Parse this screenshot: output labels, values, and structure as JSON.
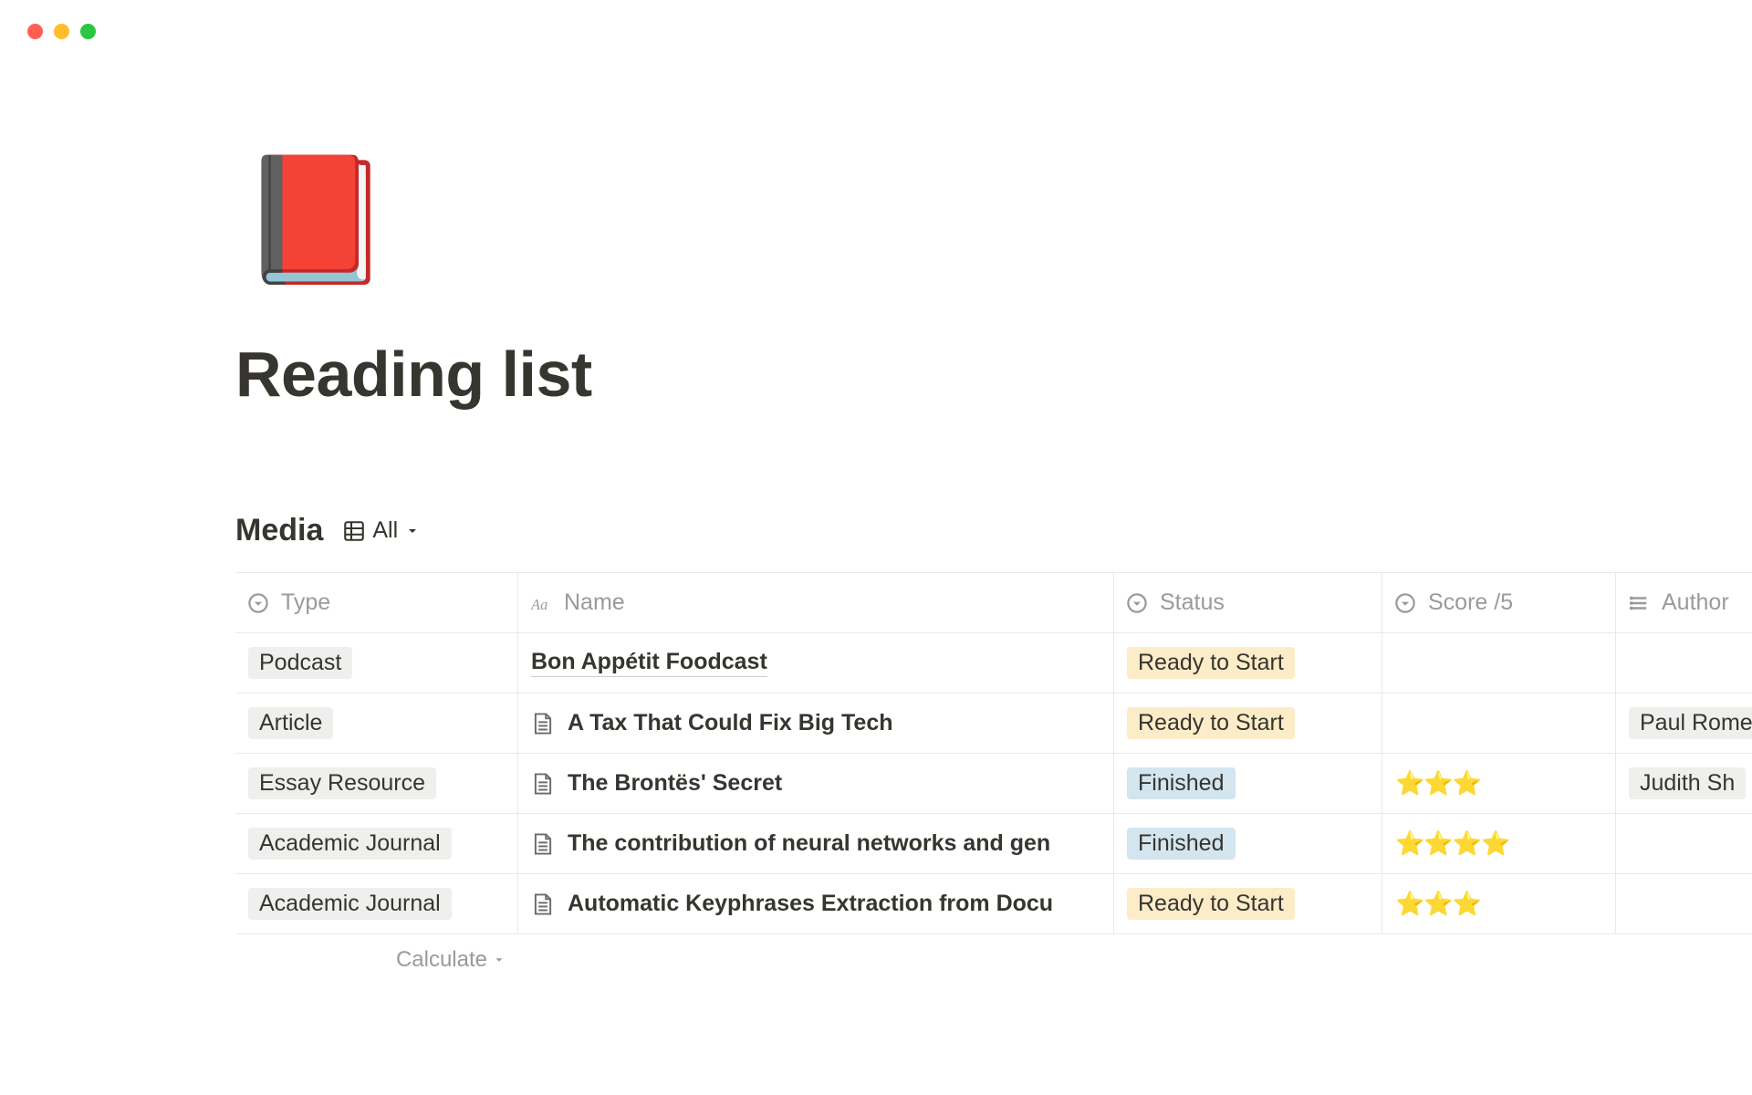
{
  "page": {
    "icon": "📕",
    "title": "Reading list"
  },
  "section": {
    "title": "Media",
    "view_label": "All"
  },
  "columns": {
    "type": "Type",
    "name": "Name",
    "status": "Status",
    "score": "Score /5",
    "author": "Author"
  },
  "status_labels": {
    "ready": "Ready to Start",
    "finished": "Finished"
  },
  "rows": [
    {
      "type": "Podcast",
      "name": "Bon Appétit Foodcast",
      "has_page_icon": false,
      "underlined": true,
      "status": "ready",
      "score": "",
      "author": ""
    },
    {
      "type": "Article",
      "name": "A Tax That Could Fix Big Tech",
      "has_page_icon": true,
      "underlined": false,
      "status": "ready",
      "score": "",
      "author": "Paul Rome"
    },
    {
      "type": "Essay Resource",
      "name": "The Brontës' Secret",
      "has_page_icon": true,
      "underlined": false,
      "status": "finished",
      "score": "⭐⭐⭐",
      "author": "Judith Sh"
    },
    {
      "type": "Academic Journal",
      "name": "The contribution of neural networks and gen",
      "has_page_icon": true,
      "underlined": false,
      "status": "finished",
      "score": "⭐⭐⭐⭐",
      "author": ""
    },
    {
      "type": "Academic Journal",
      "name": "Automatic Keyphrases Extraction from Docu",
      "has_page_icon": true,
      "underlined": false,
      "status": "ready",
      "score": "⭐⭐⭐",
      "author": ""
    }
  ],
  "footer": {
    "calculate": "Calculate"
  }
}
